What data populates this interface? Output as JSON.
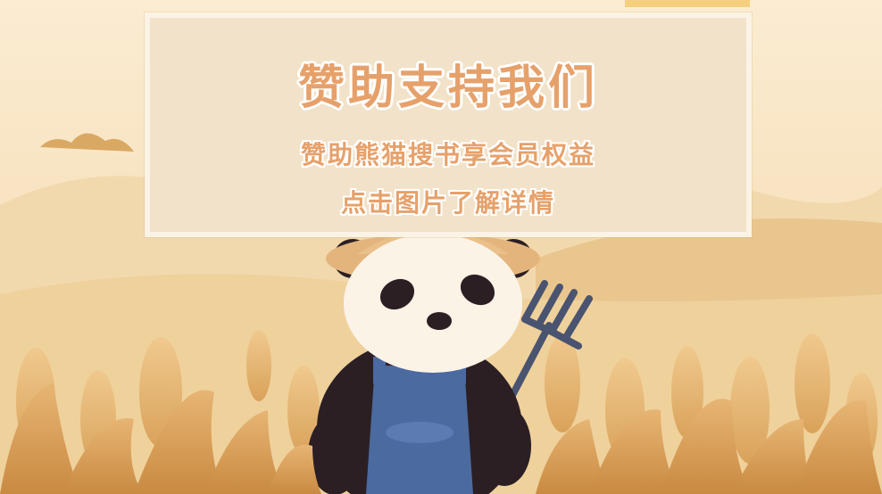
{
  "banner": {
    "title": "赞助支持我们",
    "subtitle": "赞助熊猫搜书享会员权益",
    "cta": "点击图片了解详情"
  },
  "colors": {
    "background": "#f6e3bf",
    "card": "#f1e2c9",
    "card_border": "#fbf3e6",
    "text": "#e6a16b",
    "overalls": "#4b6aa0"
  },
  "illustration": {
    "subject": "panda-farmer",
    "holding": "pitchfork-icon",
    "hat": "straw-hat-icon"
  }
}
